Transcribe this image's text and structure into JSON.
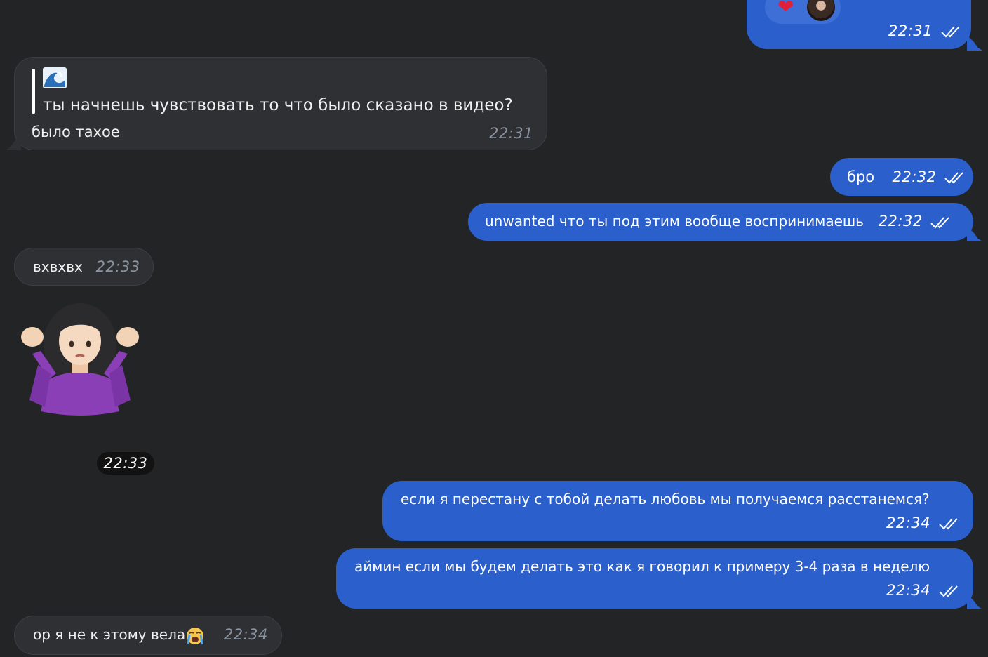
{
  "messages": {
    "m1_reaction": {
      "heart": "❤",
      "time": "22:31"
    },
    "m2_reply": {
      "quote_emoji": "🌊",
      "quote_text": "ты начнешь чувствовать то что было сказано в видео?",
      "text": "было тахое",
      "time": "22:31"
    },
    "m3": {
      "text": "бро",
      "time": "22:32"
    },
    "m4": {
      "text": "unwanted что ты под этим вообще воспринимаешь",
      "time": "22:32"
    },
    "m5": {
      "text": "вхвхвх",
      "time": "22:33"
    },
    "m6_sticker": {
      "emoji": "🤷‍♀️",
      "time": "22:33"
    },
    "m7": {
      "text": "если я перестану с тобой делать любовь мы получаемся расстанемся?",
      "time": "22:34"
    },
    "m8": {
      "text": "аймин если мы будем делать это как я говорил к примеру 3-4 раза в неделю",
      "time": "22:34"
    },
    "m9": {
      "text": "ор я не к этому вела",
      "emoji": "😭",
      "time": "22:34"
    }
  },
  "colors": {
    "background": "#222426",
    "incoming_bubble": "#2e3033",
    "outgoing_bubble": "#2b5fcc",
    "incoming_time": "#8a93a0"
  },
  "icons": [
    "double-check-icon",
    "heart-reaction-icon",
    "avatar",
    "wave-emoji",
    "shrug-sticker",
    "crying-emoji"
  ]
}
